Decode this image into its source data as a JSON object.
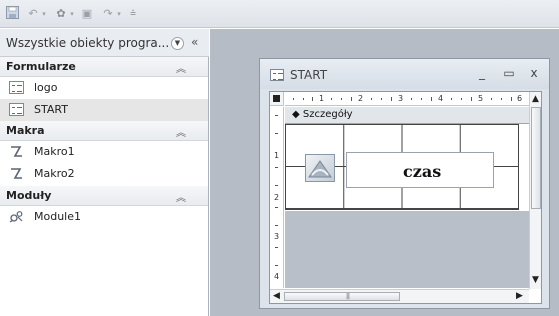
{
  "qat": {
    "icons": [
      "save-icon",
      "undo-icon",
      "macro-icon",
      "print-icon",
      "redo-icon",
      "customize-icon"
    ]
  },
  "nav": {
    "title": "Wszystkie obiekty progra...",
    "groups": [
      {
        "label": "Formularze",
        "items": [
          {
            "label": "logo",
            "icon": "form-icon"
          },
          {
            "label": "START",
            "icon": "form-icon",
            "selected": true
          }
        ]
      },
      {
        "label": "Makra",
        "items": [
          {
            "label": "Makro1",
            "icon": "macro-icon"
          },
          {
            "label": "Makro2",
            "icon": "macro-icon"
          }
        ]
      },
      {
        "label": "Moduły",
        "items": [
          {
            "label": "Module1",
            "icon": "module-icon"
          }
        ]
      }
    ]
  },
  "window": {
    "title": "START",
    "section": "Szczegóły",
    "ruler_h": [
      "1",
      "2",
      "3",
      "4",
      "5",
      "6"
    ],
    "ruler_v": [
      "1",
      "2",
      "3",
      "4"
    ],
    "textbox_text": "czas"
  },
  "colors": {
    "workspace": "#b6bcc6",
    "selected_item": "#e6e6e6"
  }
}
